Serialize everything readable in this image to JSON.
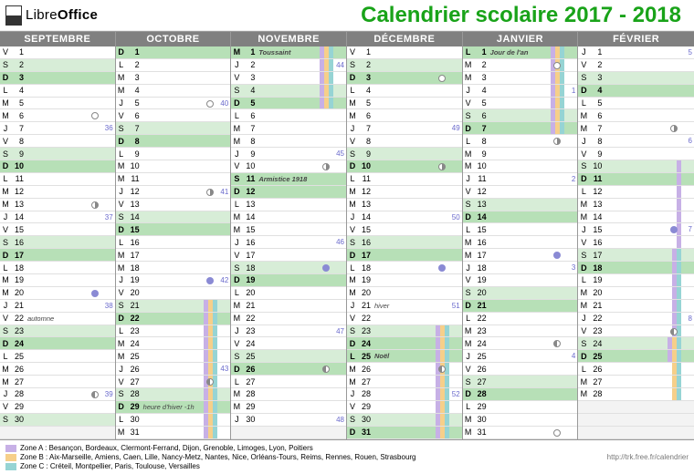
{
  "brand": {
    "a": "Libre",
    "b": "Office"
  },
  "title": "Calendrier scolaire 2017 - 2018",
  "url": "http://trk.free.fr/calendrier",
  "zones": [
    {
      "k": "A",
      "color": "#c7b0e6",
      "label": "Zone A : Besançon, Bordeaux, Clermont-Ferrand, Dijon, Grenoble, Limoges, Lyon, Poitiers"
    },
    {
      "k": "B",
      "color": "#f6cf8a",
      "label": "Zone B : Aix-Marseille, Amiens, Caen, Lille, Nancy-Metz, Nantes, Nice, Orléans-Tours, Reims, Rennes, Rouen, Strasbourg"
    },
    {
      "k": "C",
      "color": "#96d4d4",
      "label": "Zone C : Créteil, Montpellier, Paris, Toulouse, Versailles"
    }
  ],
  "months": [
    {
      "name": "SEPTEMBRE",
      "days": [
        {
          "l": "V",
          "n": 1
        },
        {
          "l": "S",
          "n": 2,
          "wkend": 1
        },
        {
          "l": "D",
          "n": 3,
          "sun": 1
        },
        {
          "l": "L",
          "n": 4
        },
        {
          "l": "M",
          "n": 5
        },
        {
          "l": "M",
          "n": 6,
          "moon": "fm"
        },
        {
          "l": "J",
          "n": 7,
          "wk": 36
        },
        {
          "l": "V",
          "n": 8
        },
        {
          "l": "S",
          "n": 9,
          "wkend": 1
        },
        {
          "l": "D",
          "n": 10,
          "sun": 1
        },
        {
          "l": "L",
          "n": 11
        },
        {
          "l": "M",
          "n": 12
        },
        {
          "l": "M",
          "n": 13,
          "moon": "lq"
        },
        {
          "l": "J",
          "n": 14,
          "wk": 37
        },
        {
          "l": "V",
          "n": 15
        },
        {
          "l": "S",
          "n": 16,
          "wkend": 1
        },
        {
          "l": "D",
          "n": 17,
          "sun": 1
        },
        {
          "l": "L",
          "n": 18
        },
        {
          "l": "M",
          "n": 19
        },
        {
          "l": "M",
          "n": 20,
          "moon": "nm"
        },
        {
          "l": "J",
          "n": 21,
          "wk": 38
        },
        {
          "l": "V",
          "n": 22,
          "nt": "automne"
        },
        {
          "l": "S",
          "n": 23,
          "wkend": 1
        },
        {
          "l": "D",
          "n": 24,
          "sun": 1
        },
        {
          "l": "L",
          "n": 25
        },
        {
          "l": "M",
          "n": 26
        },
        {
          "l": "M",
          "n": 27
        },
        {
          "l": "J",
          "n": 28,
          "moon": "hq",
          "wk": 39
        },
        {
          "l": "V",
          "n": 29
        },
        {
          "l": "S",
          "n": 30,
          "wkend": 1
        }
      ]
    },
    {
      "name": "OCTOBRE",
      "days": [
        {
          "l": "D",
          "n": 1,
          "sun": 1
        },
        {
          "l": "L",
          "n": 2
        },
        {
          "l": "M",
          "n": 3
        },
        {
          "l": "M",
          "n": 4
        },
        {
          "l": "J",
          "n": 5,
          "moon": "fm",
          "wk": 40
        },
        {
          "l": "V",
          "n": 6
        },
        {
          "l": "S",
          "n": 7,
          "wkend": 1
        },
        {
          "l": "D",
          "n": 8,
          "sun": 1
        },
        {
          "l": "L",
          "n": 9
        },
        {
          "l": "M",
          "n": 10
        },
        {
          "l": "M",
          "n": 11
        },
        {
          "l": "J",
          "n": 12,
          "moon": "lq",
          "wk": 41
        },
        {
          "l": "V",
          "n": 13
        },
        {
          "l": "S",
          "n": 14,
          "wkend": 1
        },
        {
          "l": "D",
          "n": 15,
          "sun": 1
        },
        {
          "l": "L",
          "n": 16
        },
        {
          "l": "M",
          "n": 17
        },
        {
          "l": "M",
          "n": 18
        },
        {
          "l": "J",
          "n": 19,
          "moon": "nm",
          "wk": 42
        },
        {
          "l": "V",
          "n": 20
        },
        {
          "l": "S",
          "n": 21,
          "wkend": 1,
          "bars": [
            "A",
            "B",
            "C"
          ]
        },
        {
          "l": "D",
          "n": 22,
          "sun": 1,
          "bars": [
            "A",
            "B",
            "C"
          ]
        },
        {
          "l": "L",
          "n": 23,
          "bars": [
            "A",
            "B",
            "C"
          ]
        },
        {
          "l": "M",
          "n": 24,
          "bars": [
            "A",
            "B",
            "C"
          ]
        },
        {
          "l": "M",
          "n": 25,
          "bars": [
            "A",
            "B",
            "C"
          ]
        },
        {
          "l": "J",
          "n": 26,
          "bars": [
            "A",
            "B",
            "C"
          ],
          "wk": 43
        },
        {
          "l": "V",
          "n": 27,
          "moon": "hq",
          "bars": [
            "A",
            "B",
            "C"
          ]
        },
        {
          "l": "S",
          "n": 28,
          "wkend": 1,
          "bars": [
            "A",
            "B",
            "C"
          ]
        },
        {
          "l": "D",
          "n": 29,
          "sun": 1,
          "nt": "heure d'hiver -1h",
          "bars": [
            "A",
            "B",
            "C"
          ]
        },
        {
          "l": "L",
          "n": 30,
          "bars": [
            "A",
            "B",
            "C"
          ]
        },
        {
          "l": "M",
          "n": 31,
          "bars": [
            "A",
            "B",
            "C"
          ]
        }
      ]
    },
    {
      "name": "NOVEMBRE",
      "days": [
        {
          "l": "M",
          "n": 1,
          "hol": 1,
          "nt": "Toussaint",
          "bars": [
            "A",
            "B",
            "C"
          ]
        },
        {
          "l": "J",
          "n": 2,
          "bars": [
            "A",
            "B",
            "C"
          ],
          "wk": 44
        },
        {
          "l": "V",
          "n": 3,
          "bars": [
            "A",
            "B",
            "C"
          ]
        },
        {
          "l": "S",
          "n": 4,
          "wkend": 1,
          "bars": [
            "A",
            "B",
            "C"
          ]
        },
        {
          "l": "D",
          "n": 5,
          "sun": 1,
          "bars": [
            "A",
            "B",
            "C"
          ]
        },
        {
          "l": "L",
          "n": 6
        },
        {
          "l": "M",
          "n": 7
        },
        {
          "l": "M",
          "n": 8
        },
        {
          "l": "J",
          "n": 9,
          "wk": 45
        },
        {
          "l": "V",
          "n": 10,
          "moon": "lq"
        },
        {
          "l": "S",
          "n": 11,
          "hol": 1,
          "nt": "Armistice 1918"
        },
        {
          "l": "D",
          "n": 12,
          "sun": 1
        },
        {
          "l": "L",
          "n": 13
        },
        {
          "l": "M",
          "n": 14
        },
        {
          "l": "M",
          "n": 15
        },
        {
          "l": "J",
          "n": 16,
          "wk": 46
        },
        {
          "l": "V",
          "n": 17
        },
        {
          "l": "S",
          "n": 18,
          "wkend": 1,
          "moon": "nm"
        },
        {
          "l": "D",
          "n": 19,
          "sun": 1
        },
        {
          "l": "L",
          "n": 20
        },
        {
          "l": "M",
          "n": 21
        },
        {
          "l": "M",
          "n": 22
        },
        {
          "l": "J",
          "n": 23,
          "wk": 47
        },
        {
          "l": "V",
          "n": 24
        },
        {
          "l": "S",
          "n": 25,
          "wkend": 1
        },
        {
          "l": "D",
          "n": 26,
          "sun": 1,
          "moon": "hq"
        },
        {
          "l": "L",
          "n": 27
        },
        {
          "l": "M",
          "n": 28
        },
        {
          "l": "M",
          "n": 29
        },
        {
          "l": "J",
          "n": 30,
          "wk": 48
        }
      ]
    },
    {
      "name": "DÉCEMBRE",
      "days": [
        {
          "l": "V",
          "n": 1
        },
        {
          "l": "S",
          "n": 2,
          "wkend": 1
        },
        {
          "l": "D",
          "n": 3,
          "sun": 1,
          "moon": "fm"
        },
        {
          "l": "L",
          "n": 4
        },
        {
          "l": "M",
          "n": 5
        },
        {
          "l": "M",
          "n": 6
        },
        {
          "l": "J",
          "n": 7,
          "wk": 49
        },
        {
          "l": "V",
          "n": 8
        },
        {
          "l": "S",
          "n": 9,
          "wkend": 1
        },
        {
          "l": "D",
          "n": 10,
          "sun": 1,
          "moon": "lq"
        },
        {
          "l": "L",
          "n": 11
        },
        {
          "l": "M",
          "n": 12
        },
        {
          "l": "M",
          "n": 13
        },
        {
          "l": "J",
          "n": 14,
          "wk": 50
        },
        {
          "l": "V",
          "n": 15
        },
        {
          "l": "S",
          "n": 16,
          "wkend": 1
        },
        {
          "l": "D",
          "n": 17,
          "sun": 1
        },
        {
          "l": "L",
          "n": 18,
          "moon": "nm"
        },
        {
          "l": "M",
          "n": 19
        },
        {
          "l": "M",
          "n": 20
        },
        {
          "l": "J",
          "n": 21,
          "nt": "hiver",
          "wk": 51
        },
        {
          "l": "V",
          "n": 22
        },
        {
          "l": "S",
          "n": 23,
          "wkend": 1,
          "bars": [
            "A",
            "B",
            "C"
          ]
        },
        {
          "l": "D",
          "n": 24,
          "sun": 1,
          "bars": [
            "A",
            "B",
            "C"
          ]
        },
        {
          "l": "L",
          "n": 25,
          "hol": 1,
          "nt": "Noël",
          "bars": [
            "A",
            "B",
            "C"
          ]
        },
        {
          "l": "M",
          "n": 26,
          "moon": "hq",
          "bars": [
            "A",
            "B",
            "C"
          ]
        },
        {
          "l": "M",
          "n": 27,
          "bars": [
            "A",
            "B",
            "C"
          ]
        },
        {
          "l": "J",
          "n": 28,
          "bars": [
            "A",
            "B",
            "C"
          ],
          "wk": 52
        },
        {
          "l": "V",
          "n": 29,
          "bars": [
            "A",
            "B",
            "C"
          ]
        },
        {
          "l": "S",
          "n": 30,
          "wkend": 1,
          "bars": [
            "A",
            "B",
            "C"
          ]
        },
        {
          "l": "D",
          "n": 31,
          "sun": 1,
          "bars": [
            "A",
            "B",
            "C"
          ]
        }
      ]
    },
    {
      "name": "JANVIER",
      "days": [
        {
          "l": "L",
          "n": 1,
          "hol": 1,
          "nt": "Jour de l'an",
          "bars": [
            "A",
            "B",
            "C"
          ]
        },
        {
          "l": "M",
          "n": 2,
          "moon": "fm",
          "bars": [
            "A",
            "B",
            "C"
          ]
        },
        {
          "l": "M",
          "n": 3,
          "bars": [
            "A",
            "B",
            "C"
          ]
        },
        {
          "l": "J",
          "n": 4,
          "bars": [
            "A",
            "B",
            "C"
          ],
          "wk": 1
        },
        {
          "l": "V",
          "n": 5,
          "bars": [
            "A",
            "B",
            "C"
          ]
        },
        {
          "l": "S",
          "n": 6,
          "wkend": 1,
          "bars": [
            "A",
            "B",
            "C"
          ]
        },
        {
          "l": "D",
          "n": 7,
          "sun": 1,
          "bars": [
            "A",
            "B",
            "C"
          ]
        },
        {
          "l": "L",
          "n": 8,
          "moon": "lq"
        },
        {
          "l": "M",
          "n": 9
        },
        {
          "l": "M",
          "n": 10
        },
        {
          "l": "J",
          "n": 11,
          "wk": 2
        },
        {
          "l": "V",
          "n": 12
        },
        {
          "l": "S",
          "n": 13,
          "wkend": 1
        },
        {
          "l": "D",
          "n": 14,
          "sun": 1
        },
        {
          "l": "L",
          "n": 15
        },
        {
          "l": "M",
          "n": 16
        },
        {
          "l": "M",
          "n": 17,
          "moon": "nm"
        },
        {
          "l": "J",
          "n": 18,
          "wk": 3
        },
        {
          "l": "V",
          "n": 19
        },
        {
          "l": "S",
          "n": 20,
          "wkend": 1
        },
        {
          "l": "D",
          "n": 21,
          "sun": 1
        },
        {
          "l": "L",
          "n": 22
        },
        {
          "l": "M",
          "n": 23
        },
        {
          "l": "M",
          "n": 24,
          "moon": "hq"
        },
        {
          "l": "J",
          "n": 25,
          "wk": 4
        },
        {
          "l": "V",
          "n": 26
        },
        {
          "l": "S",
          "n": 27,
          "wkend": 1
        },
        {
          "l": "D",
          "n": 28,
          "sun": 1
        },
        {
          "l": "L",
          "n": 29
        },
        {
          "l": "M",
          "n": 30
        },
        {
          "l": "M",
          "n": 31,
          "moon": "fm"
        }
      ]
    },
    {
      "name": "FÉVRIER",
      "days": [
        {
          "l": "J",
          "n": 1,
          "wk": 5
        },
        {
          "l": "V",
          "n": 2
        },
        {
          "l": "S",
          "n": 3,
          "wkend": 1
        },
        {
          "l": "D",
          "n": 4,
          "sun": 1
        },
        {
          "l": "L",
          "n": 5
        },
        {
          "l": "M",
          "n": 6
        },
        {
          "l": "M",
          "n": 7,
          "moon": "lq"
        },
        {
          "l": "J",
          "n": 8,
          "wk": 6
        },
        {
          "l": "V",
          "n": 9
        },
        {
          "l": "S",
          "n": 10,
          "wkend": 1,
          "bars": [
            "A"
          ]
        },
        {
          "l": "D",
          "n": 11,
          "sun": 1,
          "bars": [
            "A"
          ]
        },
        {
          "l": "L",
          "n": 12,
          "bars": [
            "A"
          ]
        },
        {
          "l": "M",
          "n": 13,
          "bars": [
            "A"
          ]
        },
        {
          "l": "M",
          "n": 14,
          "bars": [
            "A"
          ]
        },
        {
          "l": "J",
          "n": 15,
          "moon": "nm",
          "bars": [
            "A"
          ],
          "wk": 7
        },
        {
          "l": "V",
          "n": 16,
          "bars": [
            "A"
          ]
        },
        {
          "l": "S",
          "n": 17,
          "wkend": 1,
          "bars": [
            "A",
            "C"
          ]
        },
        {
          "l": "D",
          "n": 18,
          "sun": 1,
          "bars": [
            "A",
            "C"
          ]
        },
        {
          "l": "L",
          "n": 19,
          "bars": [
            "A",
            "C"
          ]
        },
        {
          "l": "M",
          "n": 20,
          "bars": [
            "A",
            "C"
          ]
        },
        {
          "l": "M",
          "n": 21,
          "bars": [
            "A",
            "C"
          ]
        },
        {
          "l": "J",
          "n": 22,
          "bars": [
            "A",
            "C"
          ],
          "wk": 8
        },
        {
          "l": "V",
          "n": 23,
          "moon": "hq",
          "bars": [
            "A",
            "C"
          ]
        },
        {
          "l": "S",
          "n": 24,
          "wkend": 1,
          "bars": [
            "A",
            "B",
            "C"
          ]
        },
        {
          "l": "D",
          "n": 25,
          "sun": 1,
          "bars": [
            "A",
            "B",
            "C"
          ]
        },
        {
          "l": "L",
          "n": 26,
          "bars": [
            "B",
            "C"
          ]
        },
        {
          "l": "M",
          "n": 27,
          "bars": [
            "B",
            "C"
          ]
        },
        {
          "l": "M",
          "n": 28,
          "bars": [
            "B",
            "C"
          ]
        }
      ]
    }
  ]
}
